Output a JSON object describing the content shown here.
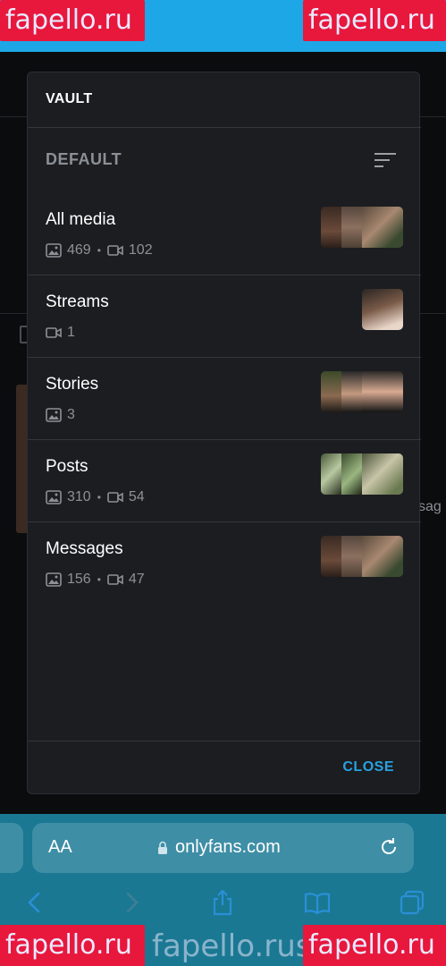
{
  "watermark": {
    "text": "fapello.ru",
    "url_text": "fapello.rus.com/the"
  },
  "modal": {
    "title": "VAULT",
    "section_title": "DEFAULT",
    "close_label": "CLOSE",
    "lists": [
      {
        "name": "All media",
        "photos": "469",
        "dot": "•",
        "videos": "102"
      },
      {
        "name": "Streams",
        "videos": "1"
      },
      {
        "name": "Stories",
        "photos": "3"
      },
      {
        "name": "Posts",
        "photos": "310",
        "dot": "•",
        "videos": "54"
      },
      {
        "name": "Messages",
        "photos": "156",
        "dot": "•",
        "videos": "47"
      }
    ]
  },
  "background": {
    "partial_text": "sag"
  },
  "browser": {
    "aa_label": "AA",
    "url": "onlyfans.com"
  },
  "colors": {
    "accent": "#27a2e0",
    "modal_bg": "#1c1d21",
    "safari_bar": "#1a7893"
  },
  "icons": [
    "sort-icon",
    "image-icon",
    "video-icon",
    "lock-icon",
    "reload-icon",
    "back-icon",
    "forward-icon",
    "share-icon",
    "bookmarks-icon",
    "tabs-icon"
  ]
}
